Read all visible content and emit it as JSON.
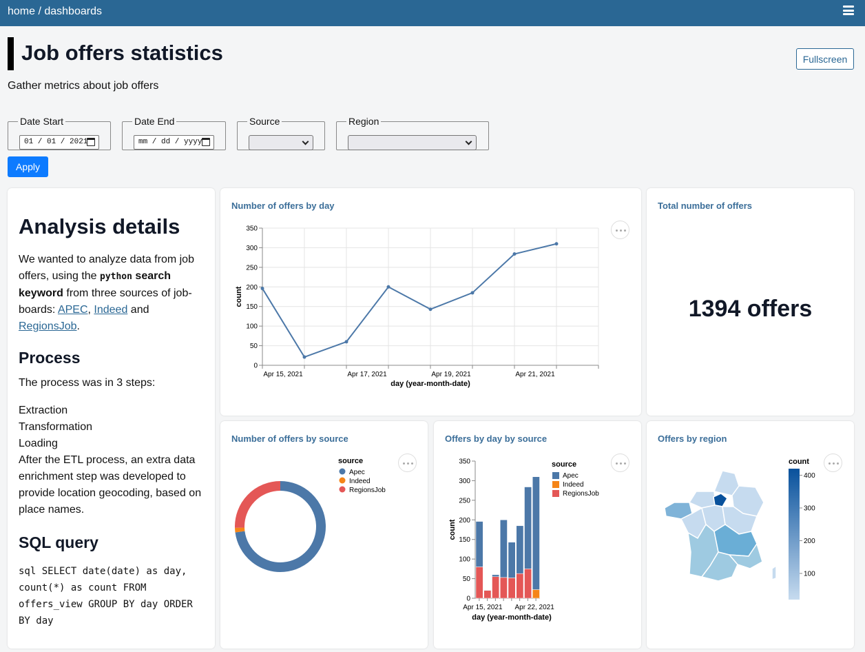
{
  "header": {
    "breadcrumb": "home / dashboards"
  },
  "page": {
    "title": "Job offers statistics",
    "subtitle": "Gather metrics about job offers",
    "fullscreen_label": "Fullscreen"
  },
  "filters": {
    "date_start": {
      "label": "Date Start",
      "value": "01 / 01 / 2021"
    },
    "date_end": {
      "label": "Date End",
      "value": "mm / dd / yyyy"
    },
    "source": {
      "label": "Source",
      "value": ""
    },
    "region": {
      "label": "Region",
      "value": ""
    },
    "apply_label": "Apply"
  },
  "analysis": {
    "heading": "Analysis details",
    "intro_1": "We wanted to analyze data from job offers, using the ",
    "keyword": "python",
    "intro_2": " search keyword",
    "intro_3": " from three sources of job-boards: ",
    "link_apec": "APEC",
    "link_indeed": "Indeed",
    "and": " and ",
    "link_regionsjob": "RegionsJob",
    "period": ".",
    "process_heading": "Process",
    "process_intro": "The process was in 3 steps:",
    "steps": [
      "Extraction",
      "Transformation",
      "Loading"
    ],
    "enrichment": "After the ETL process, an extra data enrichment step was developed to provide location geocoding, based on place names.",
    "sql_heading": "SQL query",
    "sql": "sql SELECT date(date) as day, count(*) as count FROM offers_view GROUP BY day ORDER BY day"
  },
  "cards": {
    "by_day_title": "Number of offers by day",
    "total_title": "Total number of offers",
    "total_value": "1394 offers",
    "by_source_title": "Number of offers by source",
    "by_day_source_title": "Offers by day by source",
    "by_region_title": "Offers by region"
  },
  "colors": {
    "apec": "#4c78a8",
    "indeed": "#f58518",
    "regionsjob": "#e45756",
    "accent": "#2a6794"
  },
  "chart_data": [
    {
      "type": "line",
      "title": "Number of offers by day",
      "xlabel": "day (year-month-date)",
      "ylabel": "count",
      "x": [
        "2021-04-14",
        "2021-04-15",
        "2021-04-16",
        "2021-04-17",
        "2021-04-18",
        "2021-04-19",
        "2021-04-20",
        "2021-04-21",
        "2021-04-22"
      ],
      "values": [
        196,
        21,
        60,
        200,
        143,
        185,
        284,
        310,
        null
      ],
      "points": [
        {
          "day": "2021-04-14",
          "count": 196
        },
        {
          "day": "2021-04-15",
          "count": 21
        },
        {
          "day": "2021-04-16",
          "count": 60
        },
        {
          "day": "2021-04-17",
          "count": 200
        },
        {
          "day": "2021-04-18",
          "count": 143
        },
        {
          "day": "2021-04-19",
          "count": 185
        },
        {
          "day": "2021-04-20",
          "count": 284
        },
        {
          "day": "2021-04-21",
          "count": 310
        }
      ],
      "yticks": [
        0,
        50,
        100,
        150,
        200,
        250,
        300,
        350
      ],
      "xticks": [
        "Apr 15, 2021",
        "Apr 17, 2021",
        "Apr 19, 2021",
        "Apr 21, 2021"
      ],
      "ylim": [
        0,
        350
      ]
    },
    {
      "type": "pie",
      "title": "Number of offers by source",
      "legend_title": "source",
      "series": [
        {
          "name": "Apec",
          "value": 1017
        },
        {
          "name": "Indeed",
          "value": 22
        },
        {
          "name": "RegionsJob",
          "value": 355
        }
      ]
    },
    {
      "type": "bar",
      "title": "Offers by day by source",
      "xlabel": "day (year-month-date)",
      "ylabel": "count",
      "legend_title": "source",
      "xticks": [
        "Apr 15, 2021",
        "Apr 22, 2021"
      ],
      "yticks": [
        0,
        50,
        100,
        150,
        200,
        250,
        300,
        350
      ],
      "ylim": [
        0,
        350
      ],
      "categories": [
        "Apr 15",
        "Apr 16",
        "Apr 17",
        "Apr 18",
        "Apr 19",
        "Apr 20",
        "Apr 21",
        "Apr 22"
      ],
      "series": [
        {
          "name": "RegionsJob",
          "values": [
            80,
            20,
            55,
            53,
            52,
            63,
            75,
            0
          ]
        },
        {
          "name": "Indeed",
          "values": [
            0,
            0,
            0,
            0,
            0,
            0,
            0,
            22
          ]
        },
        {
          "name": "Apec",
          "values": [
            116,
            1,
            5,
            147,
            91,
            122,
            209,
            288
          ]
        }
      ]
    },
    {
      "type": "heatmap",
      "title": "Offers by region",
      "legend_title": "count",
      "legend_ticks": [
        100,
        200,
        300,
        400
      ]
    }
  ]
}
